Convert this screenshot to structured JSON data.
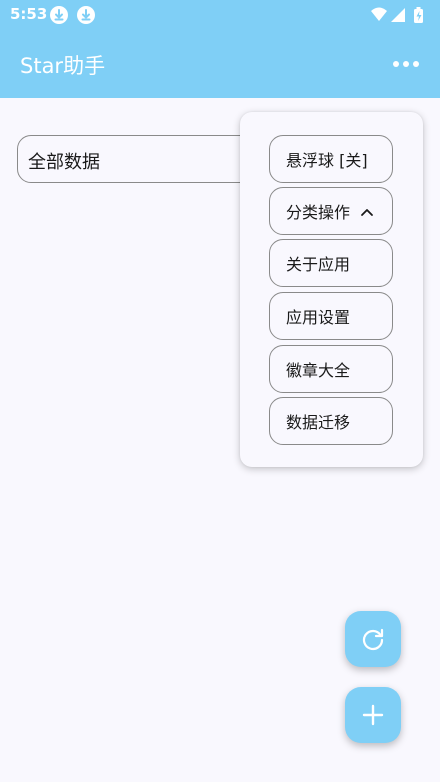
{
  "status_bar": {
    "time": "5:53",
    "icons": [
      "download-icon",
      "download-icon",
      "wifi-icon",
      "signal-icon",
      "battery-icon"
    ]
  },
  "app_bar": {
    "title": "Star助手",
    "more_icon": "more-horizontal-icon"
  },
  "filter": {
    "value": "全部数据"
  },
  "menu": {
    "items": [
      {
        "label": "悬浮球 [关]"
      },
      {
        "label": "分类操作",
        "icon": "chevron-up-icon"
      },
      {
        "label": "关于应用"
      },
      {
        "label": "应用设置"
      },
      {
        "label": "徽章大全"
      },
      {
        "label": "数据迁移"
      }
    ]
  },
  "fabs": {
    "refresh_icon": "refresh-icon",
    "add_icon": "plus-icon"
  },
  "colors": {
    "accent": "#7fcff6",
    "background": "#f9f8fe",
    "outline": "#8a8a8a"
  }
}
